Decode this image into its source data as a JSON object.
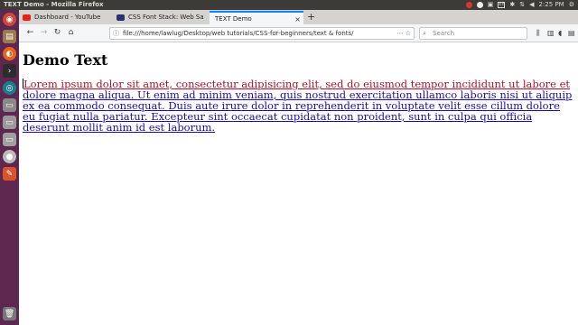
{
  "topbar": {
    "window_title": "TEXT Demo - Mozilla Firefox",
    "clock": "2:25 PM",
    "keyboard_layout": "En"
  },
  "tabs": [
    {
      "label": "Dashboard - YouTube",
      "icon": "youtube-icon",
      "active": false
    },
    {
      "label": "CSS Font Stack: Web Sa",
      "icon": "site-icon",
      "active": false
    },
    {
      "label": "TEXT Demo",
      "icon": "",
      "active": true
    }
  ],
  "navbar": {
    "url": "file:///home/lawlug/Desktop/web tutorials/CSS-for-beginners/text & fonts/",
    "search_placeholder": "Search"
  },
  "page": {
    "heading": "Demo Text",
    "first_line": "Lorem ipsum dolor sit amet, consectetur adipisicing elit, sed do eiusmod tempor incididunt ut labore et",
    "rest": "dolore magna aliqua. Ut enim ad minim veniam, quis nostrud exercitation ullamco laboris nisi ut aliquip ex ea commodo consequat. Duis aute irure dolor in reprehenderit in voluptate velit esse cillum dolore eu fugiat nulla pariatur. Excepteur sint occaecat cupidatat non proident, sunt in culpa qui officia deserunt mollit anim id est laborum."
  },
  "colors": {
    "launcher": "#5e2750",
    "link": "#1a0dab",
    "first_line_link": "#b0102a",
    "active_tab_accent": "#0a84ff"
  }
}
